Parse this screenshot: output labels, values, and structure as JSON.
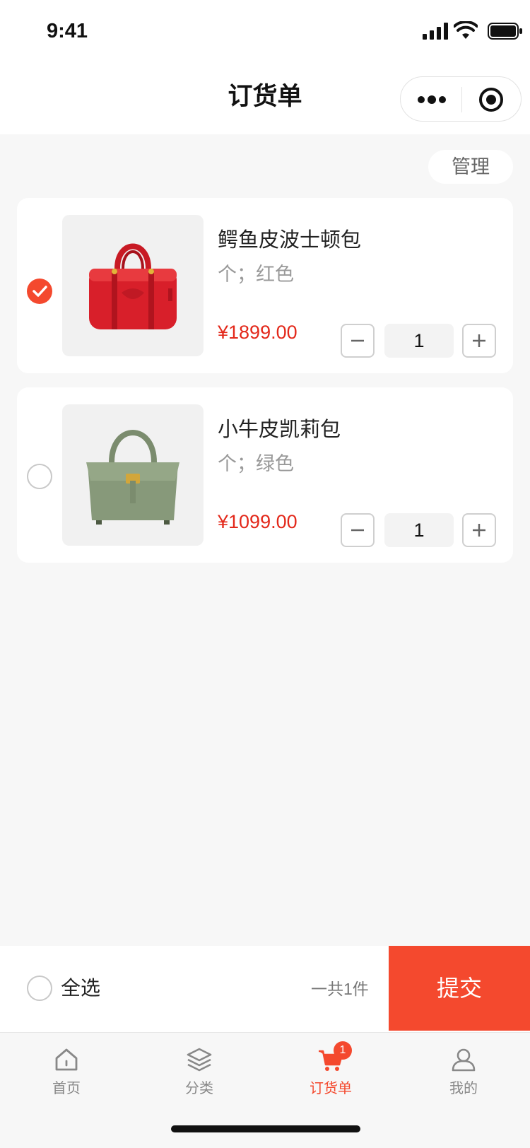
{
  "status_bar": {
    "time": "9:41"
  },
  "nav": {
    "title": "订货单"
  },
  "manage_label": "管理",
  "cart": {
    "items": [
      {
        "name": "鳄鱼皮波士顿包",
        "spec": "个；红色",
        "price": "¥1899.00",
        "quantity": "1",
        "checked": true,
        "color": "#d81f2a"
      },
      {
        "name": "小牛皮凯莉包",
        "spec": "个；绿色",
        "price": "¥1099.00",
        "quantity": "1",
        "checked": false,
        "color": "#87997a"
      }
    ]
  },
  "footer": {
    "select_all_label": "全选",
    "total_label": "一共1件",
    "submit_label": "提交"
  },
  "tabs": [
    {
      "label": "首页",
      "icon": "home-icon",
      "active": false
    },
    {
      "label": "分类",
      "icon": "layers-icon",
      "active": false
    },
    {
      "label": "订货单",
      "icon": "cart-icon",
      "active": true,
      "badge": "1"
    },
    {
      "label": "我的",
      "icon": "user-icon",
      "active": false
    }
  ],
  "colors": {
    "accent": "#f4492e",
    "price": "#e3281a",
    "background": "#f7f7f7"
  }
}
